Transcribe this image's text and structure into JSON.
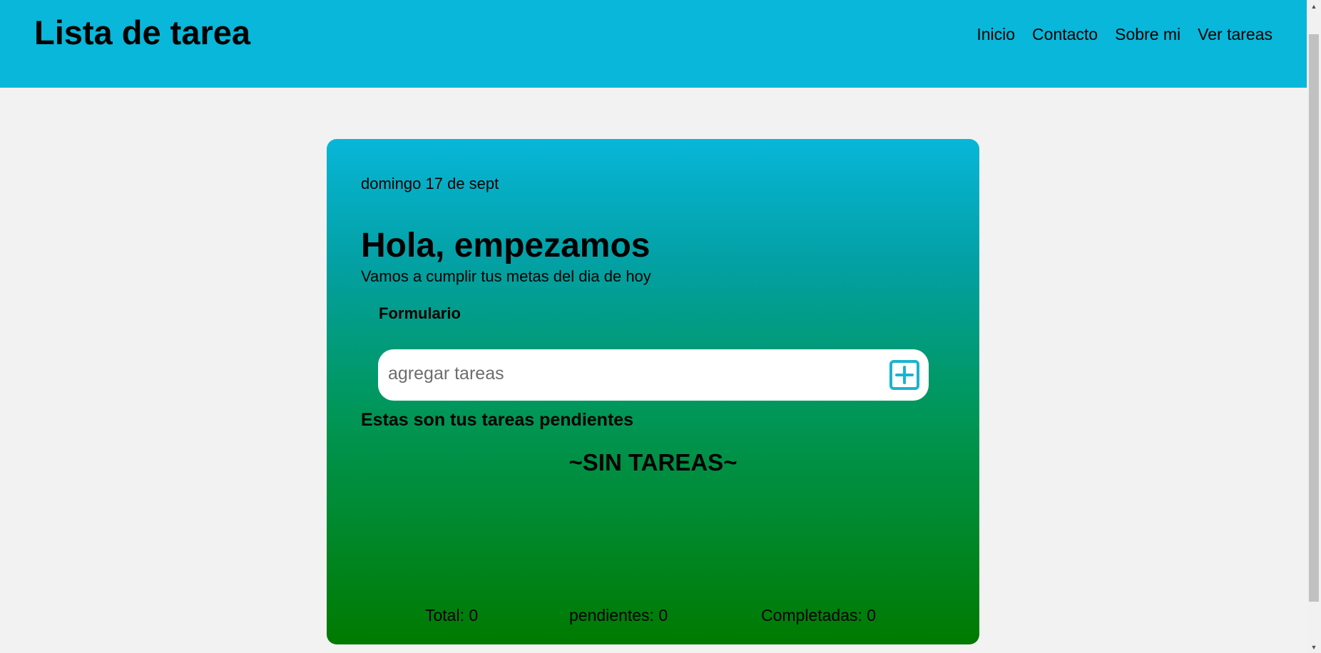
{
  "header": {
    "title": "Lista de tarea",
    "nav": [
      "Inicio",
      "Contacto",
      "Sobre mi",
      "Ver tareas"
    ],
    "bg_color": "#08b7d9"
  },
  "card": {
    "date": "domingo 17 de sept",
    "greeting": "Hola, empezamos",
    "subtitle": "Vamos a cumplir tus metas del dia de hoy",
    "form_label": "Formulario",
    "input": {
      "value": "",
      "placeholder": "agregar tareas"
    },
    "add_icon": "plus-square-icon",
    "pending_title": "Estas son tus tareas pendientes",
    "empty_message": "~SIN TAREAS~",
    "stats": {
      "total": "Total: 0",
      "pending": "pendientes: 0",
      "completed": "Completadas: 0"
    },
    "gradient_colors": [
      "#07b6d8",
      "#007a00"
    ]
  },
  "accent_color": "#1ab3d1"
}
